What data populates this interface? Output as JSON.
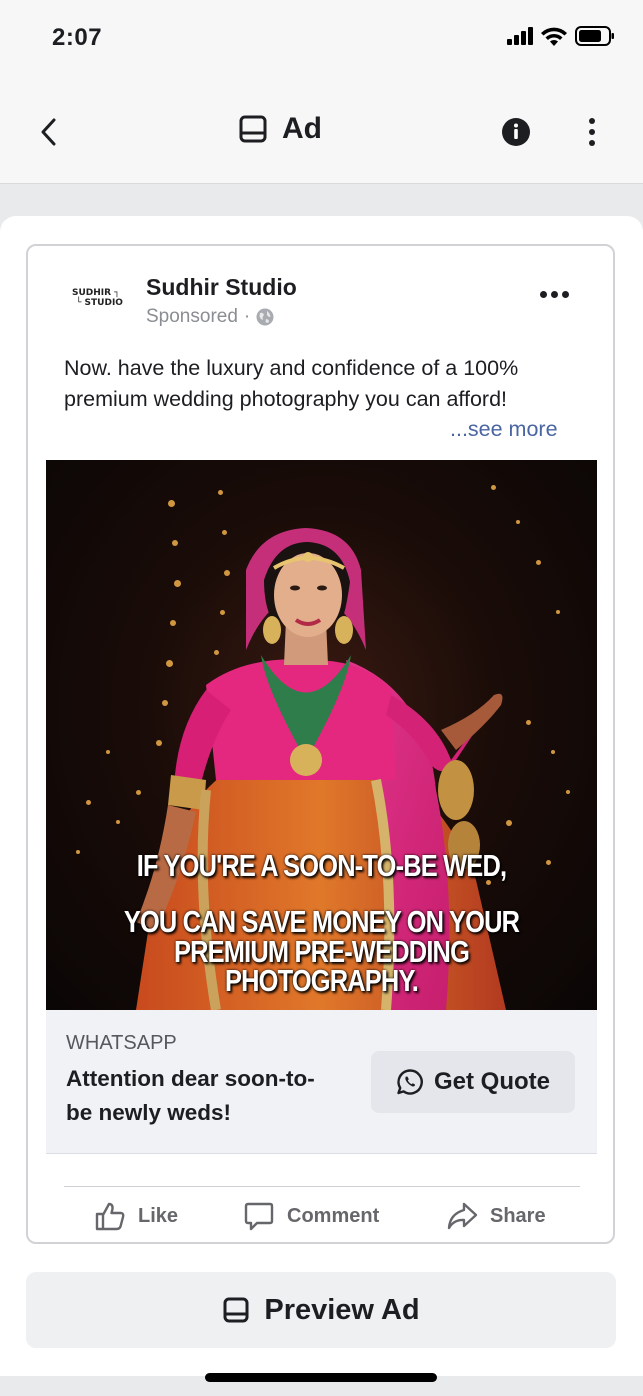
{
  "status_bar": {
    "time": "2:07"
  },
  "nav": {
    "title": "Ad"
  },
  "post": {
    "logo_line1": "SUDHIR ┐",
    "logo_line2": "└ STUDIO",
    "page_name": "Sudhir Studio",
    "sponsored": "Sponsored",
    "separator": "·",
    "text": "Now. have the luxury and confidence of a 100% premium wedding photography you can afford!",
    "see_more": "...see more",
    "image": {
      "overlay_line1": "If you're a soon-to-be wed,",
      "overlay_line2": "You can save money on your",
      "overlay_line3": "premium pre-wedding",
      "overlay_line4": "photography."
    },
    "cta": {
      "source": "WHATSAPP",
      "headline": "Attention dear soon-to-be newly weds!",
      "button_label": "Get Quote"
    },
    "actions": {
      "like": "Like",
      "comment": "Comment",
      "share": "Share"
    }
  },
  "preview_button": {
    "label": "Preview Ad"
  },
  "colors": {
    "link": "#4b65a3",
    "action_gray": "#65676b",
    "cta_bg": "#f0f2f5"
  },
  "icons": [
    "back-chevron-icon",
    "ad-icon",
    "info-icon",
    "kebab-icon",
    "globe-icon",
    "whatsapp-icon",
    "like-icon",
    "comment-icon",
    "share-icon"
  ]
}
